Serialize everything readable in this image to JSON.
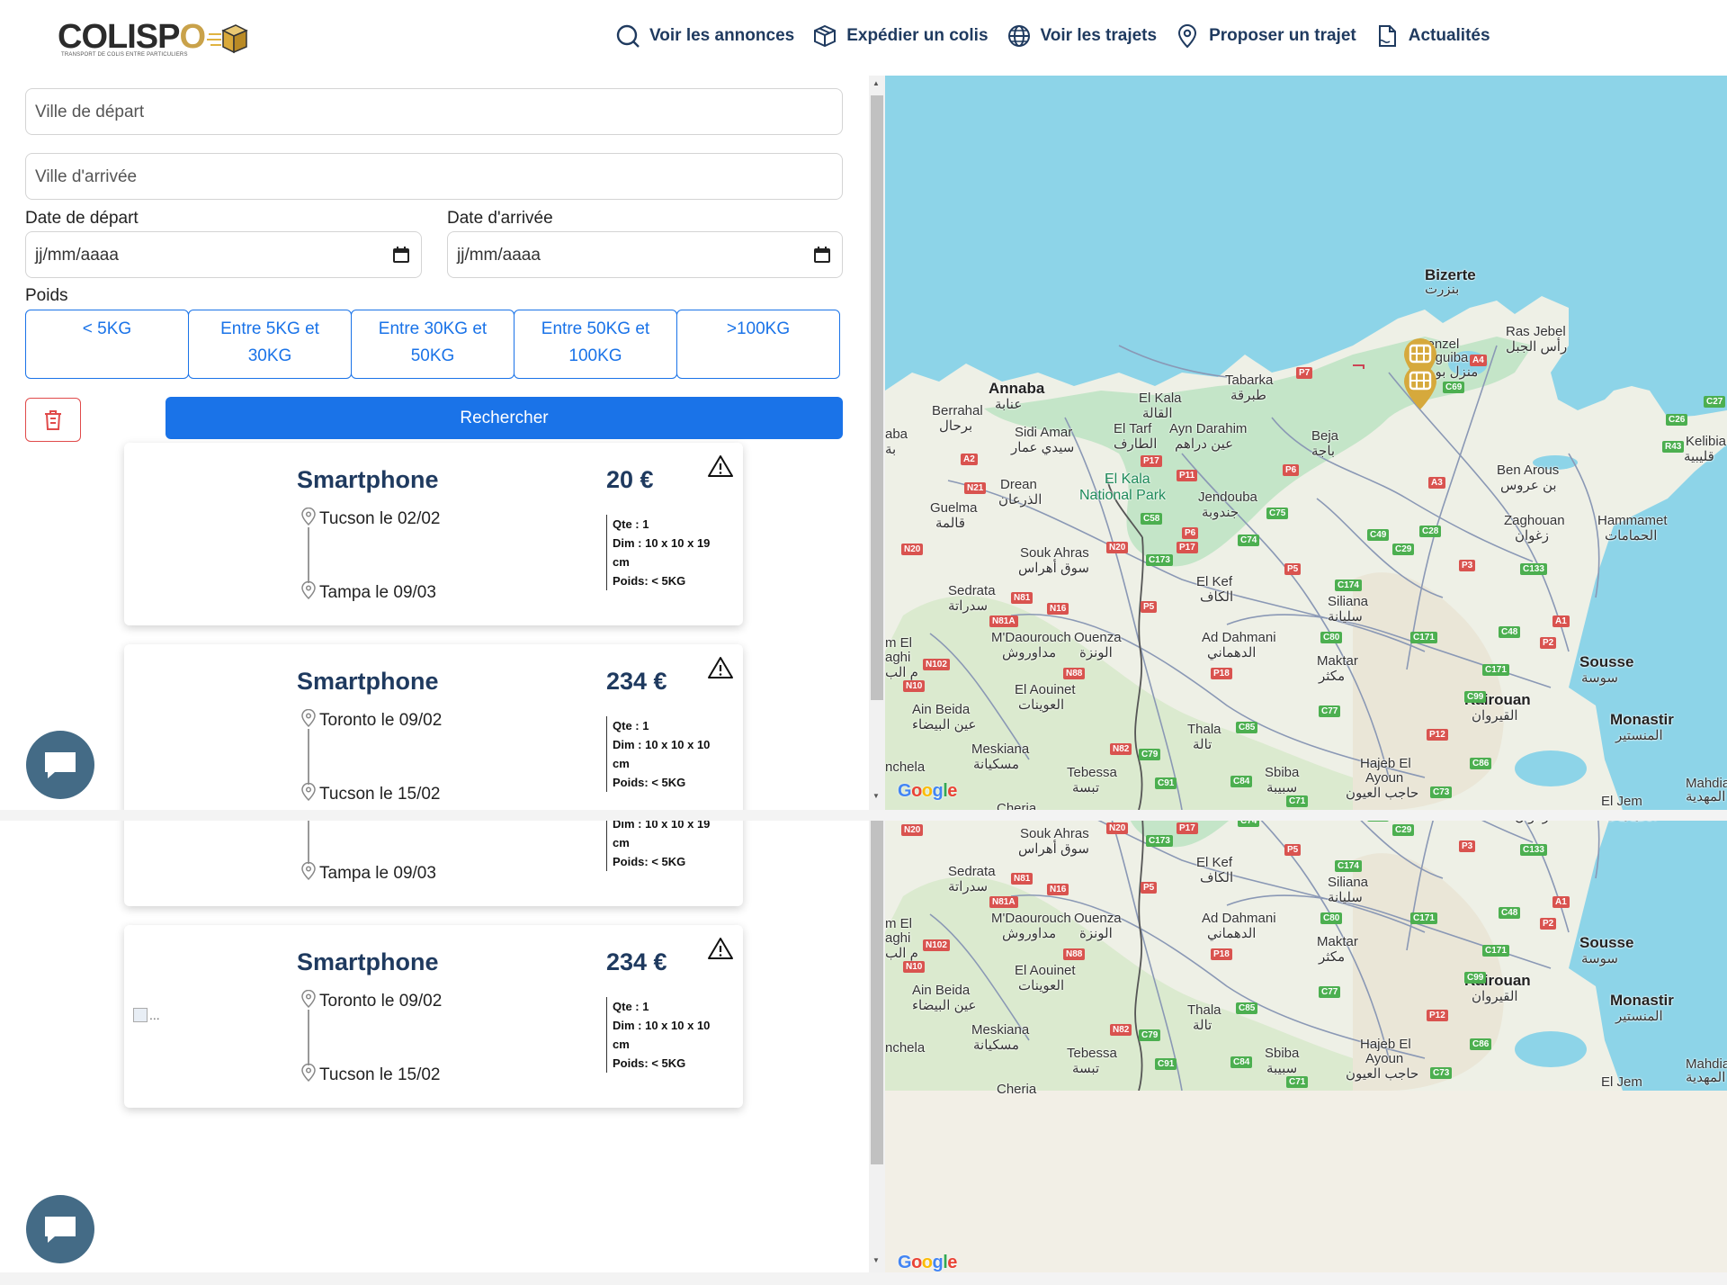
{
  "brand": {
    "name_pre": "COLISP",
    "name_o": "O",
    "tagline": "TRANSPORT DE COLIS ENTRE PARTICULIERS"
  },
  "nav": [
    {
      "label": "Voir les annonces",
      "icon": "search-icon"
    },
    {
      "label": "Expédier un colis",
      "icon": "package-icon"
    },
    {
      "label": "Voir les trajets",
      "icon": "globe-icon"
    },
    {
      "label": "Proposer un trajet",
      "icon": "map-pin-icon"
    },
    {
      "label": "Actualités",
      "icon": "document-icon"
    }
  ],
  "search": {
    "departure_placeholder": "Ville de départ",
    "arrival_placeholder": "Ville d'arrivée",
    "date_departure_label": "Date de départ",
    "date_arrival_label": "Date d'arrivée",
    "date_placeholder": "jj/mm/aaaa",
    "weight_label": "Poids",
    "weights": [
      {
        "line1": "< 5KG",
        "line2": ""
      },
      {
        "line1": "Entre 5KG et",
        "line2": "30KG"
      },
      {
        "line1": "Entre 30KG et",
        "line2": "50KG"
      },
      {
        "line1": "Entre 50KG et",
        "line2": "100KG"
      },
      {
        "line1": ">100KG",
        "line2": ""
      }
    ],
    "submit_label": "Rechercher"
  },
  "listings": [
    {
      "title": "Smartphone",
      "price": "20 €",
      "from": "Tucson le 02/02",
      "to": "Tampa le 09/03",
      "qty": "Qte : 1",
      "dim": "Dim : 10 x 10 x 19",
      "dim_unit": "cm",
      "weight": "Poids: < 5KG",
      "image_alt": "..."
    },
    {
      "title": "Smartphone",
      "price": "234 €",
      "from": "Toronto le 09/02",
      "to": "Tucson le 15/02",
      "qty": "Qte : 1",
      "dim": "Dim : 10 x 10 x 10",
      "dim_unit": "cm",
      "weight": "Poids: < 5KG",
      "image_alt": "..."
    }
  ],
  "map": {
    "attribution": "Google",
    "places": {
      "bizerte": "Bizerte",
      "bizerte_ar": "بنزرت",
      "ras_jebel": "Ras Jebel",
      "ras_jebel_ar": "رأس الجبل",
      "menzel": "Menzel",
      "bourguiba": "Bourguiba",
      "menzel_ar": "منزل بورقيبة",
      "annaba": "Annaba",
      "annaba_ar": "عنابة",
      "berrahal": "Berrahal",
      "berrahal_ar": "برحال",
      "sidi_amar": "Sidi Amar",
      "sidi_amar_ar": "سيدي عمار",
      "el_kala": "El Kala",
      "el_kala_ar": "القالة",
      "el_tarf": "El Tarf",
      "el_tarf_ar": "الطارف",
      "tabarka": "Tabarka",
      "tabarka_ar": "طبرقة",
      "ayn_darahim": "Ayn Darahim",
      "ayn_darahim_ar": "عين دراهم",
      "beja": "Beja",
      "beja_ar": "باجة",
      "park1": "El Kala",
      "park2": "National Park",
      "drean": "Drean",
      "drean_ar": "الذرعان",
      "guelma": "Guelma",
      "guelma_ar": "قالمة",
      "jendouba": "Jendouba",
      "jendouba_ar": "جندوبة",
      "ben_arous": "Ben Arous",
      "ben_arous_ar": "بن عروس",
      "zaghouan": "Zaghouan",
      "zaghouan_ar": "زغوان",
      "hammamet": "Hammamet",
      "hammamet_ar": "الحمامات",
      "kelibia": "Kelibia",
      "kelibia_ar": "قليبية",
      "souk_ahras": "Souk Ahras",
      "souk_ahras_ar": "سوق أهراس",
      "el_kef": "El Kef",
      "el_kef_ar": "الكاف",
      "siliana": "Siliana",
      "siliana_ar": "سليانة",
      "sedrata": "Sedrata",
      "sedrata_ar": "سدراتة",
      "mdaourouch": "M'Daourouch",
      "mdaourouch_ar": "مداوروش",
      "ouenza": "Ouenza",
      "ouenza_ar": "الونزة",
      "ad_dahmani": "Ad Dahmani",
      "ad_dahmani_ar": "الدهماني",
      "maktar": "Maktar",
      "maktar_ar": "مكثر",
      "sousse": "Sousse",
      "sousse_ar": "سوسة",
      "el_aouinet": "El Aouinet",
      "el_aouinet_ar": "العوينات",
      "ain_beida": "Ain Beida",
      "ain_beida_ar": "عين البيضاء",
      "kairouan": "Kairouan",
      "kairouan_ar": "القيروان",
      "monastir": "Monastir",
      "monastir_ar": "المنستير",
      "thala": "Thala",
      "thala_ar": "تالة",
      "meskiana": "Meskiana",
      "meskiana_ar": "مسكيانة",
      "tebessa": "Tebessa",
      "tebessa_ar": "تبسة",
      "sbiba": "Sbiba",
      "sbiba_ar": "سبيبة",
      "hajeb": "Hajeb El",
      "ayoun": "Ayoun",
      "hajeb_ar": "حاجب العيون",
      "mahdia": "Mahdia",
      "mahdia_ar": "المهدية",
      "el_jem": "El Jem",
      "chenchela": "nchela",
      "cheria": "Cheria",
      "el_aghi": "m El",
      "aghi": "aghi",
      "aghi_ar": "م الب",
      "aba": "aba",
      "aba_ar": "بة"
    },
    "roads": [
      "A4",
      "P7",
      "C69",
      "C27",
      "C26",
      "R43",
      "A2",
      "N21",
      "P17",
      "P11",
      "P6",
      "A3",
      "N20",
      "N20",
      "C58",
      "P6",
      "C75",
      "P17",
      "C74",
      "C49",
      "C28",
      "C29",
      "C173",
      "P5",
      "P3",
      "C133",
      "N81",
      "N16",
      "C174",
      "N81A",
      "P5",
      "C80",
      "C48",
      "A1",
      "P2",
      "N102",
      "N88",
      "P18",
      "C171",
      "C171",
      "N10",
      "C99",
      "C77",
      "C85",
      "P12",
      "C79",
      "N82",
      "C91",
      "C84",
      "C86",
      "C73",
      "C71"
    ]
  }
}
